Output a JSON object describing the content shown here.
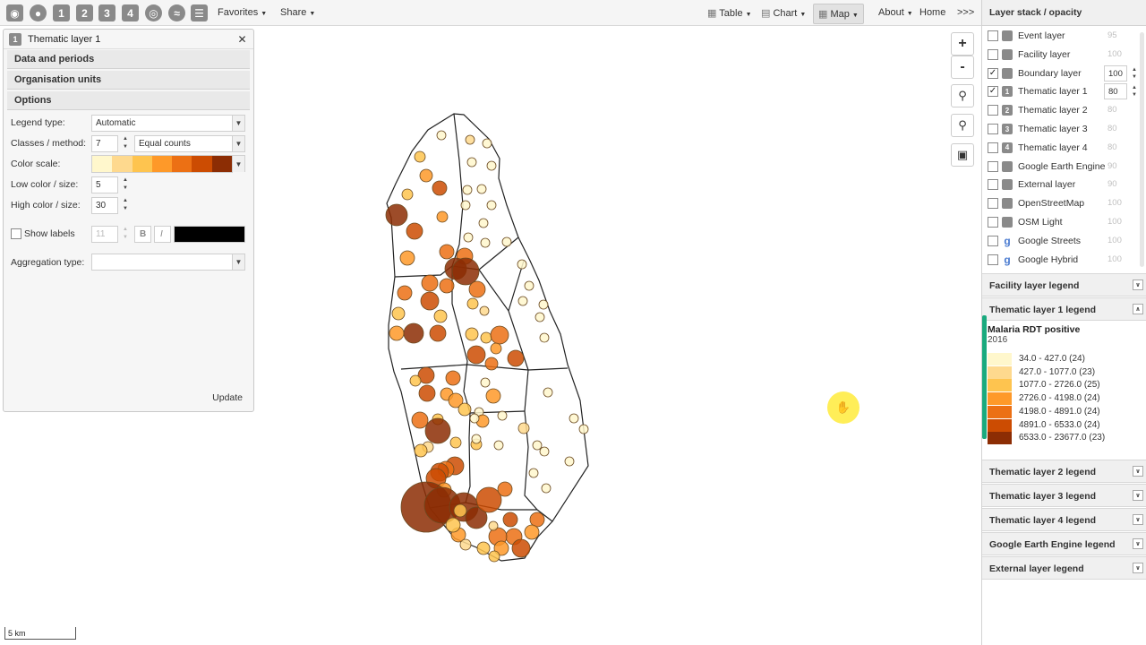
{
  "toolbar": {
    "icons": [
      "event-layer-icon",
      "facility-layer-icon",
      "thematic-layer-1-icon",
      "thematic-layer-2-icon",
      "thematic-layer-3-icon",
      "thematic-layer-4-icon",
      "boundary-layer-icon",
      "external-layer-icon",
      "layers-icon"
    ],
    "icon_labels": [
      "",
      "",
      "1",
      "2",
      "3",
      "4",
      "",
      "",
      ""
    ],
    "favorites": "Favorites",
    "share": "Share",
    "table": "Table",
    "chart": "Chart",
    "map": "Map",
    "about": "About",
    "home": "Home",
    "more": ">>>"
  },
  "left_panel": {
    "title": "Thematic layer 1",
    "number": "1",
    "sections": [
      "Data and periods",
      "Organisation units",
      "Options"
    ],
    "legend_type_label": "Legend type:",
    "legend_type_value": "Automatic",
    "classes_label": "Classes / method:",
    "classes_value": "7",
    "method_value": "Equal counts",
    "color_scale_label": "Color scale:",
    "color_scale": [
      "#fff7cc",
      "#fed98e",
      "#fec44f",
      "#fe9929",
      "#ec7014",
      "#cc4c02",
      "#8c2d04"
    ],
    "low_label": "Low color / size:",
    "low_value": "5",
    "high_label": "High color / size:",
    "high_value": "30",
    "show_labels": "Show labels",
    "font_size": "11",
    "bold": "B",
    "italic": "I",
    "aggregation_label": "Aggregation type:",
    "update": "Update"
  },
  "right_panel": {
    "title": "Layer stack / opacity",
    "layers": [
      {
        "name": "Event layer",
        "checked": false,
        "opacity": "95",
        "icon": "event-icon",
        "glyph": ""
      },
      {
        "name": "Facility layer",
        "checked": false,
        "opacity": "100",
        "icon": "facility-icon",
        "glyph": ""
      },
      {
        "name": "Boundary layer",
        "checked": true,
        "opacity": "100",
        "icon": "boundary-icon",
        "glyph": ""
      },
      {
        "name": "Thematic layer 1",
        "checked": true,
        "opacity": "80",
        "icon": "thematic-1-icon",
        "glyph": "1"
      },
      {
        "name": "Thematic layer 2",
        "checked": false,
        "opacity": "80",
        "icon": "thematic-2-icon",
        "glyph": "2"
      },
      {
        "name": "Thematic layer 3",
        "checked": false,
        "opacity": "80",
        "icon": "thematic-3-icon",
        "glyph": "3"
      },
      {
        "name": "Thematic layer 4",
        "checked": false,
        "opacity": "80",
        "icon": "thematic-4-icon",
        "glyph": "4"
      },
      {
        "name": "Google Earth Engine",
        "checked": false,
        "opacity": "90",
        "icon": "earth-engine-icon",
        "glyph": ""
      },
      {
        "name": "External layer",
        "checked": false,
        "opacity": "90",
        "icon": "external-icon",
        "glyph": ""
      },
      {
        "name": "OpenStreetMap",
        "checked": false,
        "opacity": "100",
        "icon": "osm-icon",
        "glyph": ""
      },
      {
        "name": "OSM Light",
        "checked": false,
        "opacity": "100",
        "icon": "osm-light-icon",
        "glyph": ""
      },
      {
        "name": "Google Streets",
        "checked": false,
        "opacity": "100",
        "icon": "google-icon",
        "glyph": "g"
      },
      {
        "name": "Google Hybrid",
        "checked": false,
        "opacity": "100",
        "icon": "google-icon",
        "glyph": "g"
      }
    ],
    "legend_headers": [
      "Facility layer legend",
      "Thematic layer 1 legend",
      "Thematic layer 2 legend",
      "Thematic layer 3 legend",
      "Thematic layer 4 legend",
      "Google Earth Engine legend",
      "External layer legend"
    ],
    "legend": {
      "title": "Malaria RDT positive",
      "period": "2016",
      "items": [
        {
          "label": "34.0 - 427.0 (24)",
          "color": "#fff7cc"
        },
        {
          "label": "427.0 - 1077.0 (23)",
          "color": "#fed98e"
        },
        {
          "label": "1077.0 - 2726.0 (25)",
          "color": "#fec44f"
        },
        {
          "label": "2726.0 - 4198.0 (24)",
          "color": "#fe9929"
        },
        {
          "label": "4198.0 - 4891.0 (24)",
          "color": "#ec7014"
        },
        {
          "label": "4891.0 - 6533.0 (24)",
          "color": "#cc4c02"
        },
        {
          "label": "6533.0 - 23677.0 (23)",
          "color": "#8c2d04"
        }
      ]
    }
  },
  "map": {
    "zoom_in": "+",
    "zoom_out": "-",
    "scale": "5 km"
  }
}
